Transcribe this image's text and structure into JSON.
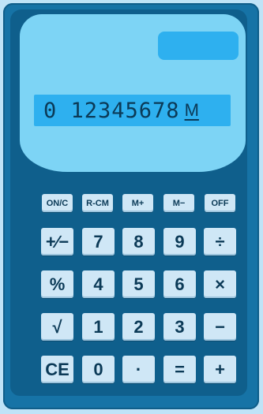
{
  "display": {
    "digits": "0 12345678",
    "memory_indicator": "M"
  },
  "buttons": {
    "row1": [
      "ON/C",
      "R-CM",
      "M+",
      "M−",
      "OFF"
    ],
    "row2": [
      "+∕−",
      "7",
      "8",
      "9",
      "÷"
    ],
    "row3": [
      "%",
      "4",
      "5",
      "6",
      "×"
    ],
    "row4": [
      "√",
      "1",
      "2",
      "3",
      "−"
    ],
    "row5": [
      "CE",
      "0",
      "·",
      "=",
      "+"
    ]
  },
  "colors": {
    "body": "#1673a6",
    "face": "#0f5f8c",
    "upper_panel": "#7dd4f5",
    "lcd": "#2eb0ef",
    "buttons": "#cfe7f6",
    "text": "#0b3a57"
  }
}
